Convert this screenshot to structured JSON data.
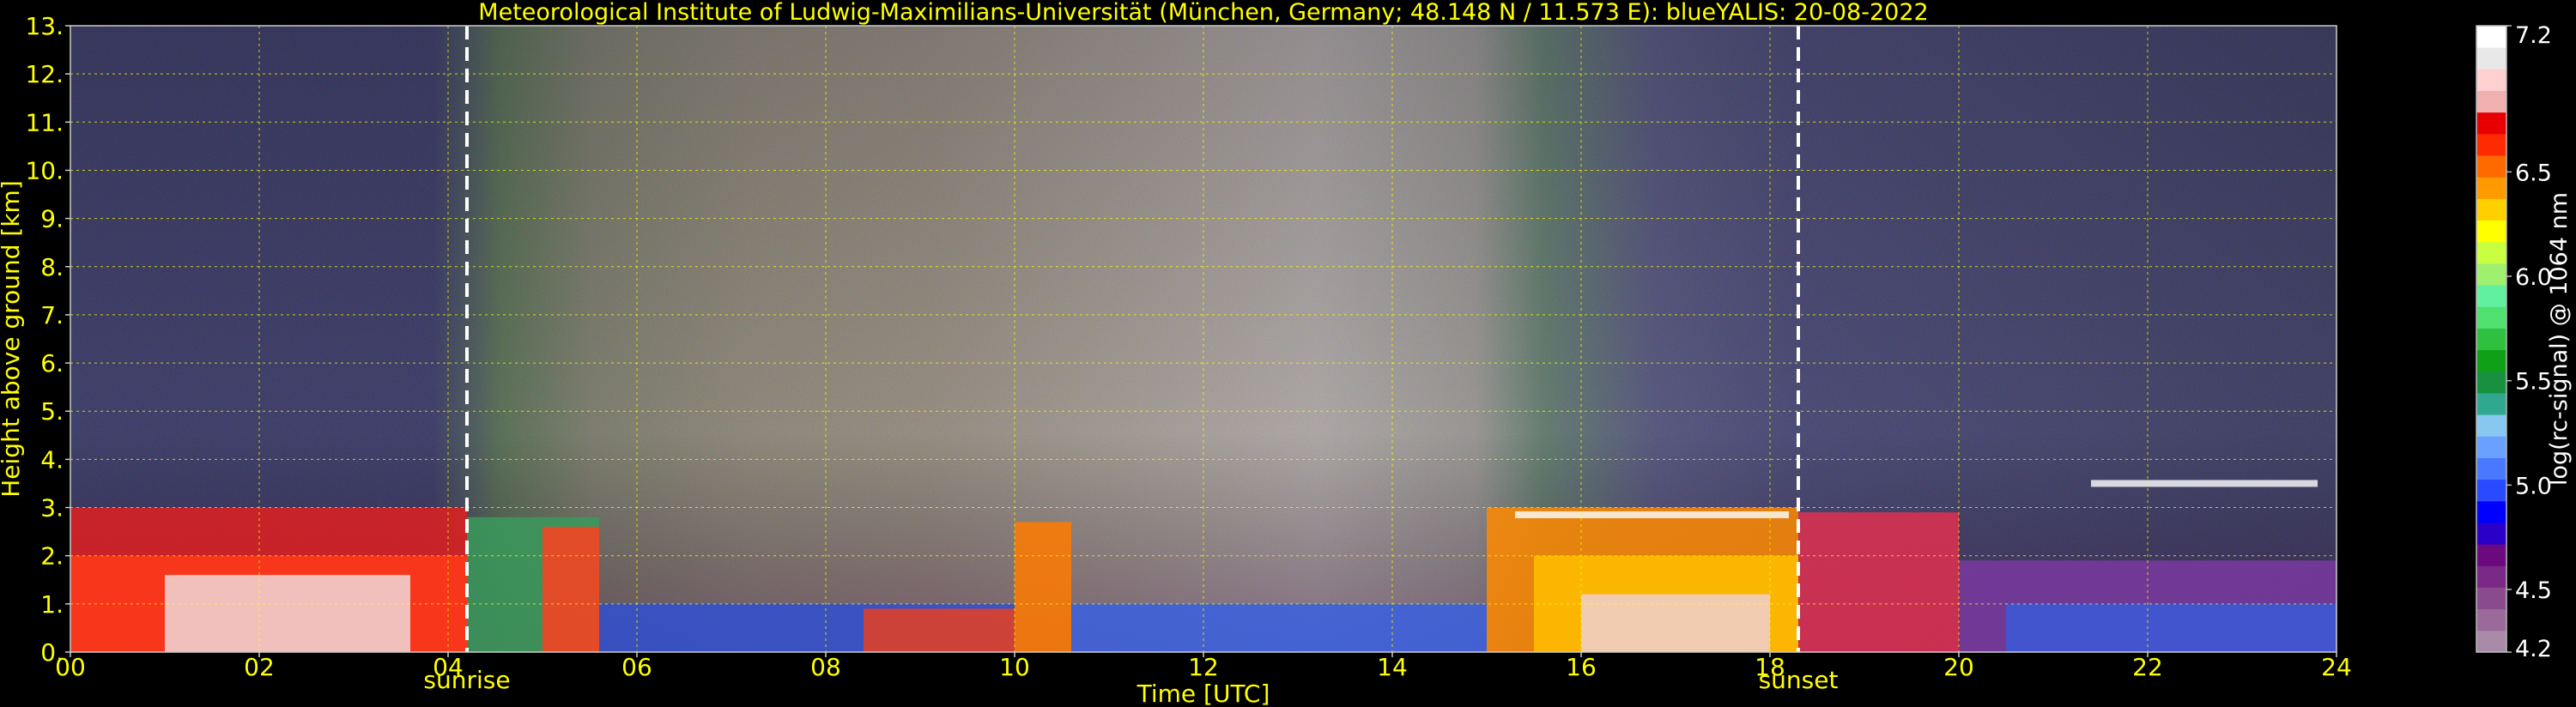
{
  "chart_data": {
    "type": "heatmap",
    "title": "Meteorological Institute of Ludwig-Maximilians-Universität (München, Germany; 48.148 N / 11.573 E):    blueYALIS: 20-08-2022",
    "xlabel": "Time [UTC]",
    "ylabel": "Height above ground [km]",
    "xlim": [
      0,
      24
    ],
    "ylim": [
      0,
      13
    ],
    "x_ticks": [
      "00",
      "02",
      "04",
      "06",
      "08",
      "10",
      "12",
      "14",
      "16",
      "18",
      "20",
      "22",
      "24"
    ],
    "y_ticks": [
      "0.",
      "1.",
      "2.",
      "3.",
      "4.",
      "5.",
      "6.",
      "7.",
      "8.",
      "9.",
      "10.",
      "11.",
      "12.",
      "13."
    ],
    "grid": true,
    "annotations": [
      {
        "label": "sunrise",
        "time_utc": 4.2
      },
      {
        "label": "sunset",
        "time_utc": 18.3
      }
    ],
    "colorbar": {
      "label": "log(rc-signal) @ 1064 nm",
      "min": 4.2,
      "max": 7.2,
      "tick_values": [
        4.2,
        4.5,
        5.0,
        5.5,
        6.0,
        6.5,
        7.2
      ],
      "tick_labels": [
        "4.2",
        "4.5",
        "5.0",
        "5.5",
        "6.0",
        "6.5",
        "7.2"
      ],
      "colors": [
        "#a88aa8",
        "#9a6a9a",
        "#8a4a8e",
        "#7a2a86",
        "#6a0a7e",
        "#2a00c8",
        "#0000ff",
        "#2a4aff",
        "#4a78ff",
        "#6aa0ff",
        "#88c8f0",
        "#30a890",
        "#189040",
        "#10a018",
        "#30c040",
        "#50e070",
        "#60f0a0",
        "#a0f070",
        "#c8ff40",
        "#ffff00",
        "#ffd000",
        "#ff9a00",
        "#ff6a00",
        "#ff2a00",
        "#e80000",
        "#f0b0b0",
        "#ffd0d0",
        "#e8e8e8",
        "#ffffff"
      ]
    }
  }
}
